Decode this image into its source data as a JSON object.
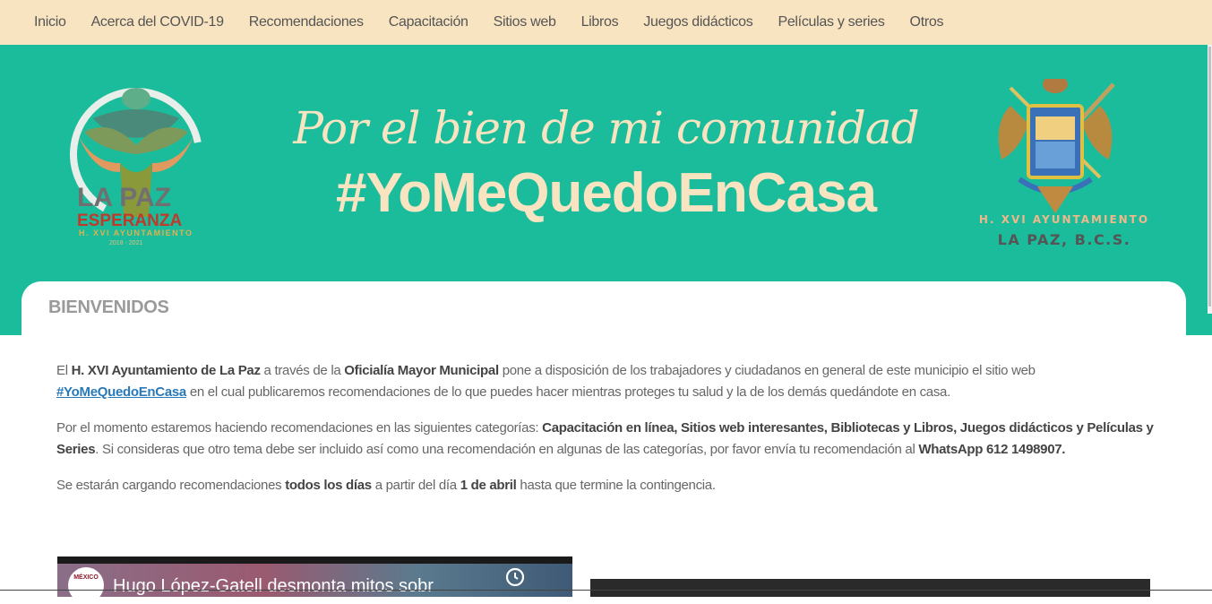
{
  "nav": {
    "items": [
      "Inicio",
      "Acerca del COVID-19",
      "Recomendaciones",
      "Capacitación",
      "Sitios web",
      "Libros",
      "Juegos didácticos",
      "Películas y series",
      "Otros"
    ]
  },
  "banner": {
    "tagline": "Por el bien de mi comunidad",
    "hashtag": "#YoMeQuedoEnCasa",
    "left_logo": {
      "line1": "LA PAZ",
      "line2": "ESPERANZA",
      "line3": "H. XVI AYUNTAMIENTO",
      "line4": "2018 - 2021",
      "icon": "la-paz-esperanza-logo"
    },
    "right_logo": {
      "line1": "H. XVI AYUNTAMIENTO",
      "line2": "LA PAZ, B.C.S.",
      "icon": "coat-of-arms-icon"
    },
    "colors": {
      "teal": "#1abc9c",
      "cream": "#f9e4c1"
    }
  },
  "card": {
    "title": "BIENVENIDOS",
    "p1": {
      "t1": "El ",
      "b1": "H. XVI Ayuntamiento de La Paz",
      "t2": " a través de la ",
      "b2": "Oficialía Mayor Municipal",
      "t3": " pone a disposición de los trabajadores y ciudadanos en general de este municipio el sitio web ",
      "link": "#YoMeQuedoEnCasa",
      "t4": " en el cual publicaremos recomendaciones de lo que puedes hacer mientras proteges tu salud y la de los demás quedándote en casa."
    },
    "p2": {
      "t1": "Por el momento estaremos haciendo recomendaciones en las siguientes categorías: ",
      "b1": "Capacitación en línea, Sitios web interesantes, Bibliotecas y Libros, Juegos didácticos y Películas y Series",
      "t2": ". Si consideras que otro tema debe ser incluido así como una recomendación en algunas de las categorías, por favor envía tu recomendación al ",
      "b2": "WhatsApp 612 1498907."
    },
    "p3": {
      "t1": "Se estarán cargando recomendaciones ",
      "b1": "todos los días",
      "t2": " a partir del día ",
      "b2": "1 de abril",
      "t3": " hasta que termine la contingencia."
    }
  },
  "video1": {
    "title": "Hugo López-Gatell desmonta mitos sobr",
    "channel": "MÉXICO"
  }
}
